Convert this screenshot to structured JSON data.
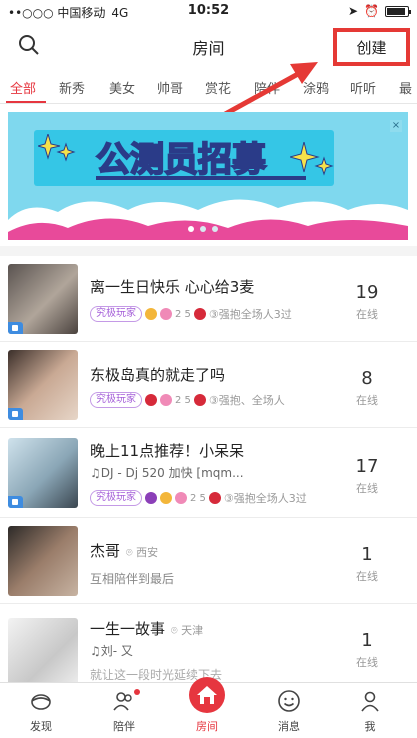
{
  "status_bar": {
    "carrier": "••○○○ 中国移动",
    "network": "4G",
    "time": "10:52"
  },
  "nav": {
    "title": "房间",
    "create_label": "创建"
  },
  "tabs": [
    "全部",
    "新秀",
    "美女",
    "帅哥",
    "赏花",
    "陪伴",
    "涂鸦",
    "听听",
    "最"
  ],
  "active_tab": 0,
  "banner": {
    "title_part1": "公测员",
    "title_part2": "招募",
    "close": "×",
    "pages": 3,
    "current_page": 1
  },
  "rooms": [
    {
      "title": "离一生日快乐 心心给3麦",
      "badge": "究极玩家",
      "gifts": "2 5",
      "meta": "③强抱全场人3过",
      "count": "19",
      "count_label": "在线"
    },
    {
      "title": "东极岛真的就走了吗",
      "badge": "究极玩家",
      "gifts": "2 5",
      "meta": "③强抱、全场人",
      "count": "8",
      "count_label": "在线"
    },
    {
      "title": "晚上11点推荐！小呆呆",
      "subtitle": "♫DJ - Dj 520 加快 [mqm...",
      "badge": "究极玩家",
      "gifts": "2 5",
      "meta": "③强抱全场人3过",
      "count": "17",
      "count_label": "在线"
    },
    {
      "title": "杰哥",
      "location": "西安",
      "subtitle": "互相陪伴到最后",
      "count": "1",
      "count_label": "在线"
    },
    {
      "title": "一生一故事",
      "location": "天津",
      "subtitle": "♫刘- 又",
      "subtitle2": "就让这一段时光延续下去",
      "count": "1",
      "count_label": "在线"
    }
  ],
  "bottom_tabs": [
    {
      "label": "发现",
      "icon": "discover-icon"
    },
    {
      "label": "陪伴",
      "icon": "friends-icon"
    },
    {
      "label": "房间",
      "icon": "house-icon"
    },
    {
      "label": "消息",
      "icon": "message-icon"
    },
    {
      "label": "我",
      "icon": "profile-icon"
    }
  ],
  "colors": {
    "accent": "#e6363f",
    "highlight_box": "#e53935",
    "badge": "#a45ed8"
  }
}
